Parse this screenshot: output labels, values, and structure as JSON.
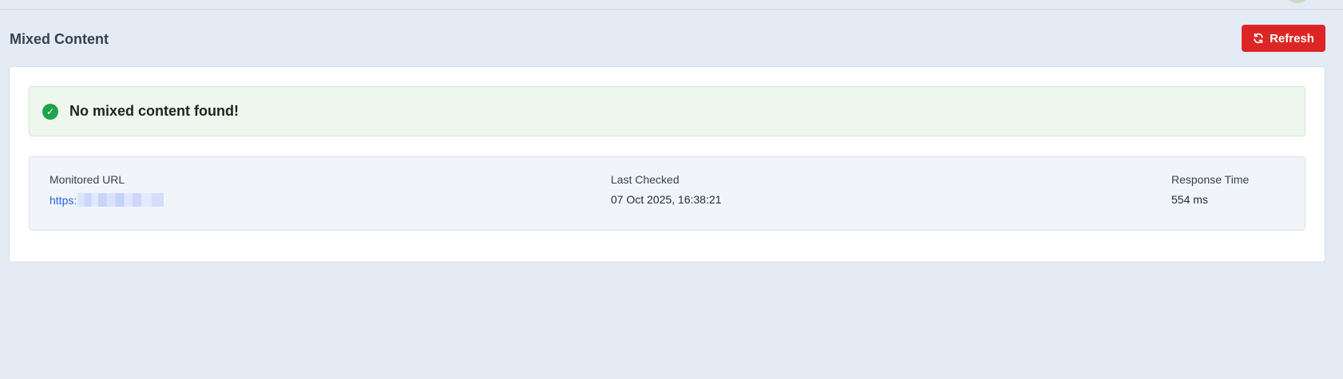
{
  "page": {
    "title": "Mixed Content"
  },
  "toolbar": {
    "refresh_label": "Refresh",
    "refresh_icon": "refresh-icon"
  },
  "alert": {
    "icon": "check-circle-icon",
    "message": "No mixed content found!"
  },
  "info": {
    "monitored_url": {
      "label": "Monitored URL",
      "value": "https:"
    },
    "last_checked": {
      "label": "Last Checked",
      "value": "07 Oct 2025, 16:38:21"
    },
    "response_time": {
      "label": "Response Time",
      "value": "554 ms"
    }
  },
  "colors": {
    "background": "#e4ebf5",
    "accent_red": "#dc2626",
    "success_green": "#22a24a",
    "link_blue": "#2563eb"
  }
}
